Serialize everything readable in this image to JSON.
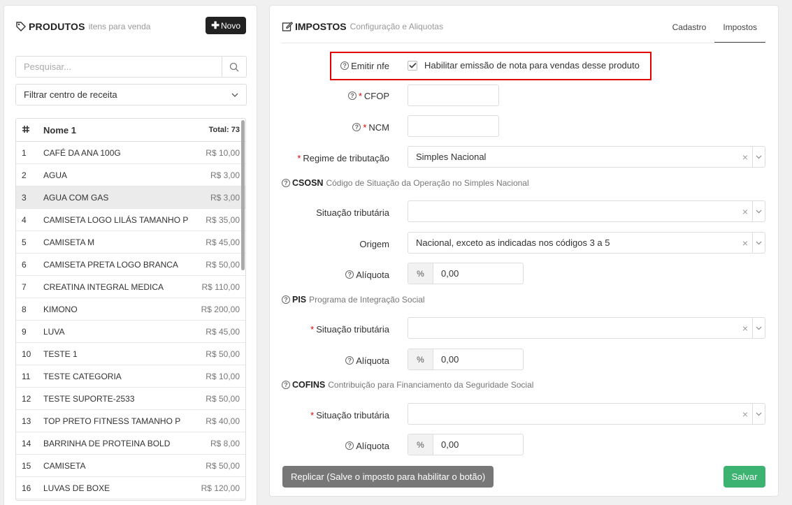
{
  "products_panel": {
    "title": "PRODUTOS",
    "subtitle": "itens para venda",
    "new_button": "Novo",
    "search_placeholder": "Pesquisar...",
    "filter_label": "Filtrar centro de receita",
    "table": {
      "name_header": "Nome 1",
      "total": "Total: 73",
      "rows": [
        {
          "num": "1",
          "name": "CAFÉ DA ANA 100G",
          "price": "R$ 10,00"
        },
        {
          "num": "2",
          "name": "AGUA",
          "price": "R$ 3,00"
        },
        {
          "num": "3",
          "name": "AGUA COM GAS",
          "price": "R$ 3,00"
        },
        {
          "num": "4",
          "name": "CAMISETA LOGO LILÁS TAMANHO P",
          "price": "R$ 35,00"
        },
        {
          "num": "5",
          "name": "CAMISETA M",
          "price": "R$ 45,00"
        },
        {
          "num": "6",
          "name": "CAMISETA PRETA LOGO BRANCA",
          "price": "R$ 50,00"
        },
        {
          "num": "7",
          "name": "CREATINA INTEGRAL MEDICA",
          "price": "R$ 110,00"
        },
        {
          "num": "8",
          "name": "KIMONO",
          "price": "R$ 200,00"
        },
        {
          "num": "9",
          "name": "LUVA",
          "price": "R$ 45,00"
        },
        {
          "num": "10",
          "name": "TESTE 1",
          "price": "R$ 50,00"
        },
        {
          "num": "11",
          "name": "TESTE CATEGORIA",
          "price": "R$ 10,00"
        },
        {
          "num": "12",
          "name": "TESTE SUPORTE-2533",
          "price": "R$ 50,00"
        },
        {
          "num": "13",
          "name": "TOP PRETO FITNESS TAMANHO P",
          "price": "R$ 40,00"
        },
        {
          "num": "14",
          "name": "BARRINHA DE PROTEINA BOLD",
          "price": "R$ 8,00"
        },
        {
          "num": "15",
          "name": "CAMISETA",
          "price": "R$ 50,00"
        },
        {
          "num": "16",
          "name": "LUVAS DE BOXE",
          "price": "R$ 120,00"
        }
      ]
    }
  },
  "taxes_panel": {
    "title": "IMPOSTOS",
    "subtitle": "Configuração e Aliquotas",
    "tabs": [
      "Cadastro",
      "Impostos"
    ],
    "emitir_label": "Emitir nfe",
    "emitir_checkbox_text": "Habilitar emissão de nota para vendas desse produto",
    "cfop_label": "CFOP",
    "ncm_label": "NCM",
    "regime_label": "Regime de tributação",
    "regime_value": "Simples Nacional",
    "csosn": {
      "code": "CSOSN",
      "desc": "Código de Situação da Operação no Simples Nacional",
      "situacao_label": "Situação tributária",
      "origem_label": "Origem",
      "origem_value": "Nacional, exceto as indicadas nos códigos 3 a 5",
      "aliquota_label": "Alíquota",
      "aliquota_value": "0,00"
    },
    "pis": {
      "code": "PIS",
      "desc": "Programa de Integração Social",
      "situacao_label": "Situação tributária",
      "aliquota_label": "Alíquota",
      "aliquota_value": "0,00"
    },
    "cofins": {
      "code": "COFINS",
      "desc": "Contribuição para Financiamento da Seguridade Social",
      "situacao_label": "Situação tributária",
      "aliquota_label": "Alíquota",
      "aliquota_value": "0,00"
    },
    "percent_symbol": "%",
    "replicar_button": "Replicar (Salve o imposto para habilitar o botão)",
    "salvar_button": "Salvar"
  }
}
